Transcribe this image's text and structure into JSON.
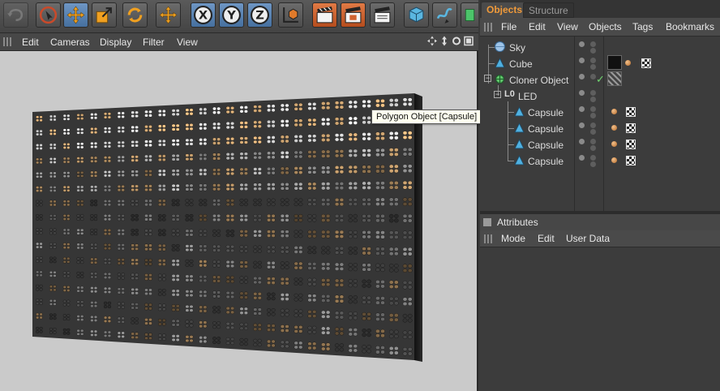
{
  "toolbar": {
    "buttons": [
      {
        "name": "undo-icon",
        "active": false
      },
      {
        "name": "live-selection-icon",
        "active": false
      },
      {
        "name": "move-icon",
        "active": true
      },
      {
        "name": "scale-icon",
        "active": false
      },
      {
        "name": "rotate-icon",
        "active": false
      },
      {
        "name": "recent-tool-icon",
        "active": false
      },
      {
        "name": "x-axis-lock-icon",
        "active": true
      },
      {
        "name": "y-axis-lock-icon",
        "active": true
      },
      {
        "name": "z-axis-lock-icon",
        "active": true
      },
      {
        "name": "coordinate-system-icon",
        "active": false
      },
      {
        "name": "render-view-icon",
        "active": false
      },
      {
        "name": "render-picture-viewer-icon",
        "active": false
      },
      {
        "name": "render-settings-icon",
        "active": false
      },
      {
        "name": "cube-primitive-icon",
        "active": false
      },
      {
        "name": "spline-pen-icon",
        "active": false
      },
      {
        "name": "nurbs-icon",
        "active": false
      }
    ]
  },
  "viewport": {
    "menu": [
      "Edit",
      "Cameras",
      "Display",
      "Filter",
      "View"
    ],
    "tooltip": "Polygon Object [Capsule]"
  },
  "object_manager": {
    "tabs": [
      {
        "label": "Objects",
        "active": true
      },
      {
        "label": "Structure",
        "active": false
      }
    ],
    "menu": [
      "File",
      "Edit",
      "View",
      "Objects",
      "Tags",
      "Bookmarks"
    ],
    "objects": [
      {
        "name": "Sky",
        "depth": 0,
        "icon": "sky-icon",
        "tags": []
      },
      {
        "name": "Cube",
        "depth": 0,
        "icon": "polygon-object-icon",
        "tags": [
          "cube-texture-tag",
          "phong-tag",
          "uvw-tag"
        ]
      },
      {
        "name": "Cloner Object",
        "depth": 0,
        "icon": "cloner-icon",
        "tags": [
          "check-icon",
          "texture-tag"
        ]
      },
      {
        "name": "LED",
        "depth": 1,
        "icon": "null-object-icon",
        "tags": []
      },
      {
        "name": "Capsule",
        "depth": 2,
        "icon": "polygon-object-icon",
        "tags": [
          "phong-tag",
          "uvw-tag"
        ]
      },
      {
        "name": "Capsule",
        "depth": 2,
        "icon": "polygon-object-icon",
        "tags": [
          "phong-tag",
          "uvw-tag"
        ]
      },
      {
        "name": "Capsule",
        "depth": 2,
        "icon": "polygon-object-icon",
        "tags": [
          "phong-tag",
          "uvw-tag"
        ]
      },
      {
        "name": "Capsule",
        "depth": 2,
        "icon": "polygon-object-icon",
        "tags": [
          "phong-tag",
          "uvw-tag"
        ]
      }
    ]
  },
  "attributes": {
    "title": "Attributes",
    "menu": [
      "Mode",
      "Edit",
      "User Data"
    ]
  },
  "colors": {
    "active_tab": "#f09a3a",
    "toolbar_active": "#5a83b3",
    "render_button": "#d0622f",
    "viewport_bg": "#cacaca"
  }
}
